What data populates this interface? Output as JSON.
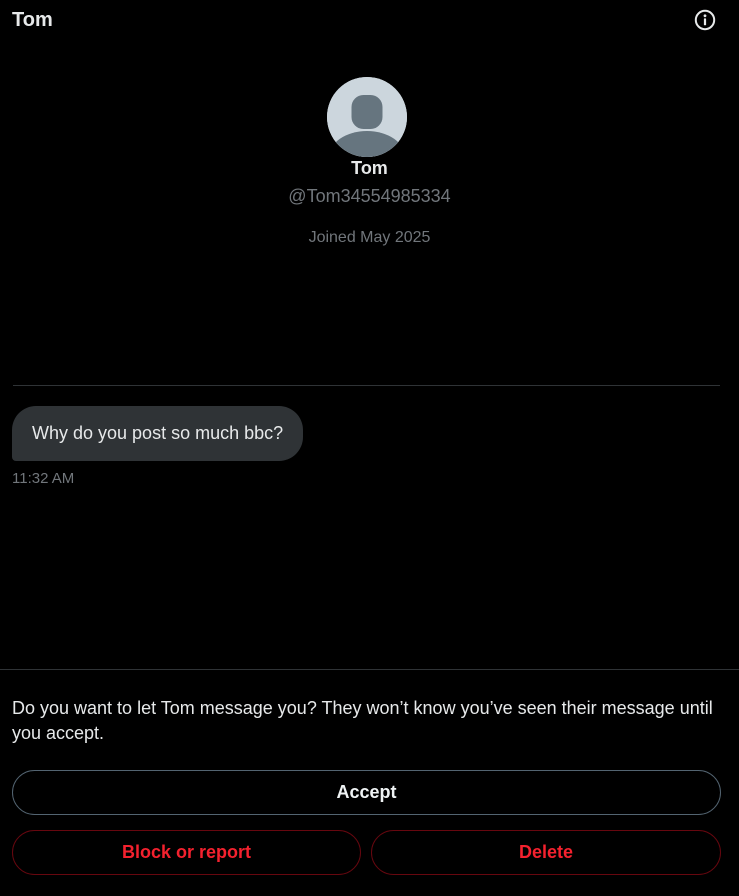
{
  "header": {
    "title": "Tom",
    "info_icon": "info-circle-icon"
  },
  "profile": {
    "avatar_icon": "default-avatar-icon",
    "name": "Tom",
    "handle": "@Tom34554985334",
    "joined": "Joined May 2025"
  },
  "messages": [
    {
      "text": "Why do you post so much bbc?",
      "time": "11:32 AM",
      "direction": "incoming"
    }
  ],
  "request": {
    "prompt": "Do you want to let Tom message you? They won’t know you’ve seen their message until you accept.",
    "accept_label": "Accept",
    "block_label": "Block or report",
    "delete_label": "Delete"
  },
  "colors": {
    "background": "#000000",
    "text_primary": "#e7e9ea",
    "text_secondary": "#71767b",
    "bubble": "#2f3336",
    "danger": "#f4212e",
    "divider": "#2f3336"
  }
}
